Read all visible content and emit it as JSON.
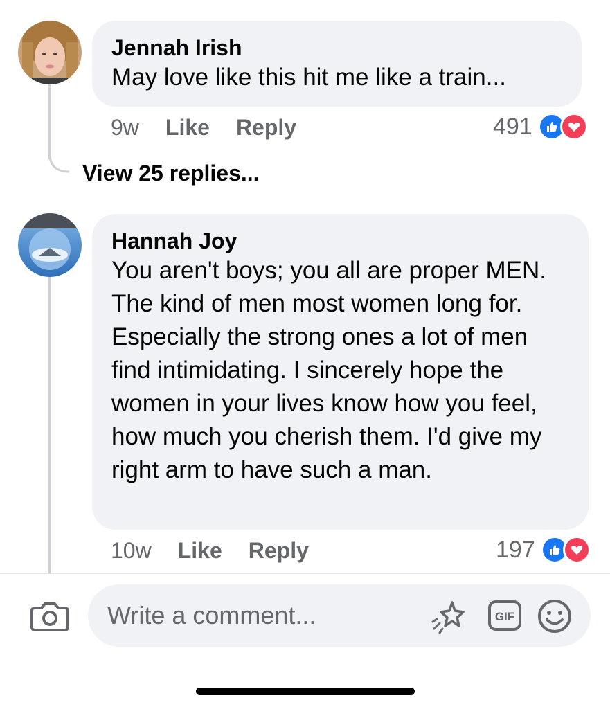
{
  "comments": [
    {
      "author": "Jennah Irish",
      "text": "May love like this hit me like a train...",
      "time": "9w",
      "like_label": "Like",
      "reply_label": "Reply",
      "reaction_count": "491",
      "view_replies": "View 25 replies..."
    },
    {
      "author": "Hannah Joy",
      "text": "You aren't boys; you all are proper MEN. The kind of men most women long for. Especially the strong ones a lot of men find intimidating. I sincerely hope the women in your lives know how you feel, how much you cherish them. I'd give my right arm to have such a man.",
      "time": "10w",
      "like_label": "Like",
      "reply_label": "Reply",
      "reaction_count": "197"
    }
  ],
  "composer": {
    "placeholder": "Write a comment...",
    "icons": [
      "camera-icon",
      "sparkle-icon",
      "gif-icon",
      "emoji-icon"
    ]
  },
  "colors": {
    "like_blue": "#1877f2",
    "love_red": "#f33e58",
    "bubble_bg": "#f0f2f5",
    "meta_gray": "#65676b"
  }
}
